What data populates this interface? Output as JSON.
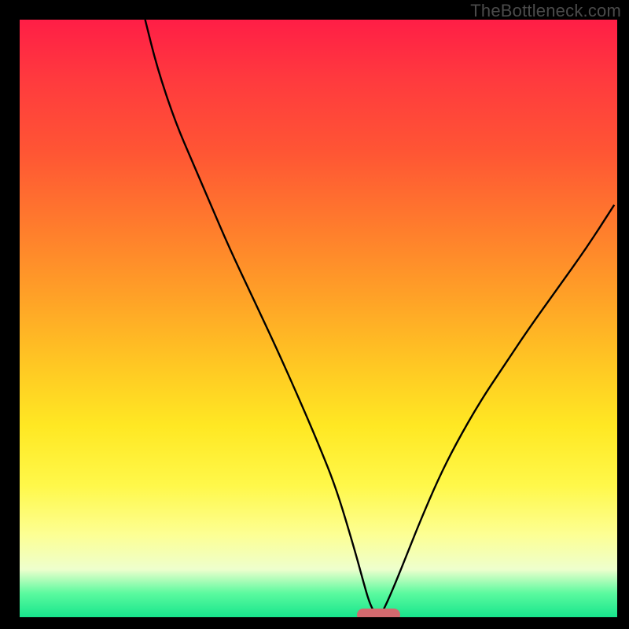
{
  "watermark": "TheBottleneck.com",
  "chart_data": {
    "type": "line",
    "title": "",
    "xlabel": "",
    "ylabel": "",
    "xlim": [
      0,
      100
    ],
    "ylim": [
      0,
      100
    ],
    "grid": false,
    "series": [
      {
        "name": "curve",
        "x": [
          21,
          23,
          26,
          29,
          32,
          35,
          39,
          43,
          47,
          50,
          53,
          56,
          57.5,
          58.5,
          59.5,
          60.5,
          61.5,
          63,
          65,
          67,
          70,
          73,
          77,
          81,
          85,
          90,
          95,
          99.5
        ],
        "y": [
          100,
          92,
          83,
          76,
          69,
          62,
          53.5,
          45,
          36,
          29,
          21.5,
          11.5,
          6,
          2.5,
          0.5,
          0.5,
          2.5,
          6,
          11,
          16,
          23,
          29,
          36,
          42,
          48,
          55,
          62,
          69
        ]
      }
    ],
    "marker": {
      "x": 60,
      "y": 0,
      "color": "#d36a6f"
    },
    "background": {
      "stops": [
        {
          "pos": 0,
          "color": "#ff1e46"
        },
        {
          "pos": 10,
          "color": "#ff3a3e"
        },
        {
          "pos": 22,
          "color": "#ff5534"
        },
        {
          "pos": 34,
          "color": "#ff7a2d"
        },
        {
          "pos": 46,
          "color": "#ffa027"
        },
        {
          "pos": 58,
          "color": "#ffc823"
        },
        {
          "pos": 68,
          "color": "#ffe823"
        },
        {
          "pos": 78,
          "color": "#fff84a"
        },
        {
          "pos": 86,
          "color": "#fdff92"
        },
        {
          "pos": 92,
          "color": "#eeffcd"
        },
        {
          "pos": 96,
          "color": "#5bfa9f"
        },
        {
          "pos": 100,
          "color": "#17e58c"
        }
      ]
    }
  }
}
